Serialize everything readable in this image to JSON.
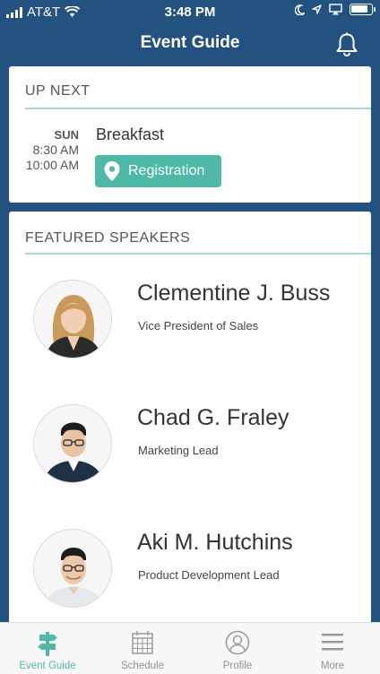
{
  "status_bar": {
    "carrier": "AT&T",
    "time": "3:48 PM"
  },
  "header": {
    "title": "Event Guide"
  },
  "up_next": {
    "section_title": "UP NEXT",
    "event": {
      "day": "SUN",
      "start_time": "8:30 AM",
      "end_time": "10:00 AM",
      "title": "Breakfast",
      "location": "Registration"
    }
  },
  "speakers": {
    "section_title": "FEATURED SPEAKERS",
    "items": [
      {
        "name": "Clementine J. Buss",
        "role": "Vice President of Sales"
      },
      {
        "name": "Chad G. Fraley",
        "role": "Marketing Lead"
      },
      {
        "name": "Aki M. Hutchins",
        "role": "Product Development Lead"
      }
    ]
  },
  "tabs": [
    {
      "label": "Event Guide",
      "icon": "signpost-icon",
      "active": true
    },
    {
      "label": "Schedule",
      "icon": "calendar-icon",
      "active": false
    },
    {
      "label": "Profile",
      "icon": "profile-icon",
      "active": false
    },
    {
      "label": "More",
      "icon": "menu-icon",
      "active": false
    }
  ],
  "colors": {
    "header_bg": "#245280",
    "accent": "#4fb9a7",
    "rule": "#a8d8d0"
  }
}
